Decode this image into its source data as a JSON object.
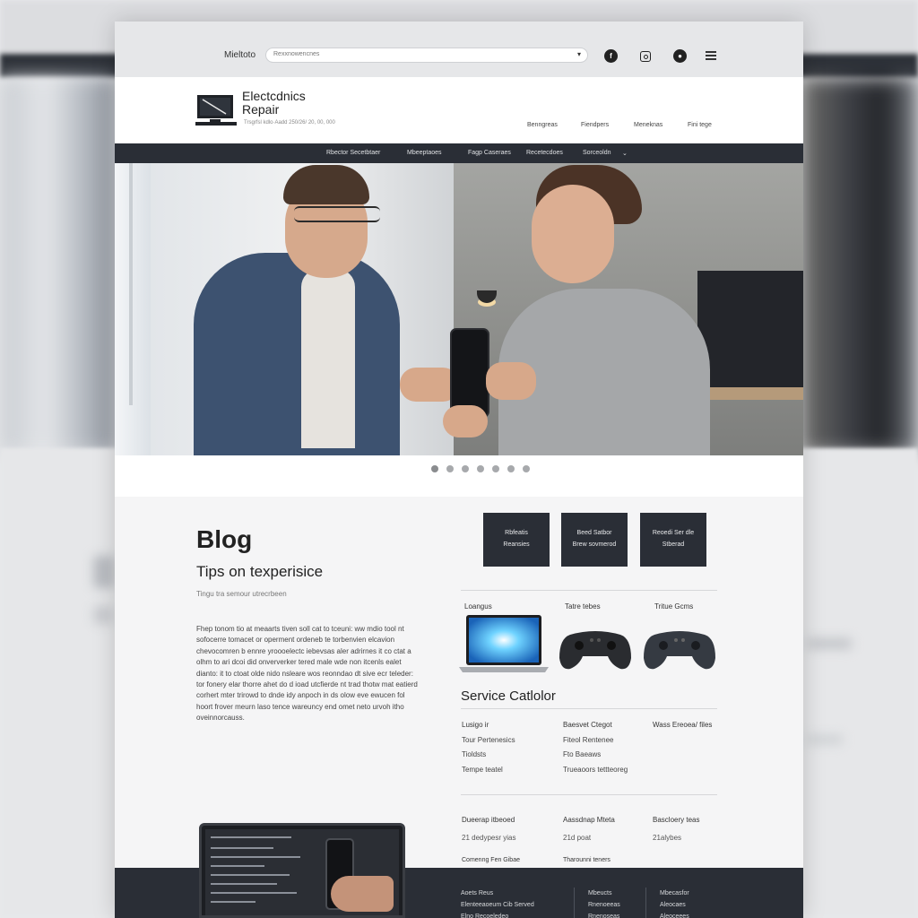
{
  "colors": {
    "dark_nav": "#2a2e36",
    "page_bg": "#f5f5f6",
    "accent_text": "#222222"
  },
  "topbar": {
    "brand": "Mieltoto",
    "search_placeholder": "Rexxnowencnes",
    "social_icons": [
      "facebook-icon",
      "instagram-icon",
      "social-icon",
      "menu-icon"
    ]
  },
  "header": {
    "title_line1": "Electcdnics",
    "title_line2": "Repair",
    "tagline": "Trsgrfsl kdlo·Aadd 250/26/ 20, 00, 000",
    "nav": [
      "Benngreas",
      "Fiendpers",
      "Meneknas",
      "Fini tege"
    ]
  },
  "navbar": {
    "items": [
      "Rbector Secetbtaer",
      "Mbeeptaoes",
      "Fagp Caseraes",
      "Recetecdoes",
      "Sorceoldn"
    ]
  },
  "hero": {
    "slides": 7,
    "active_slide": 0
  },
  "blog": {
    "title": "Blog",
    "subtitle": "Tips on texperisice",
    "meta": "Tingu tra semour utrecrbeen",
    "paragraph": "Fhep tonom tio at meaarts tiven soll cat to tceuni: ww mdio tool nt sofocerre tomacet or operment ordeneb te torbenvien elcavion chevocomren b ennre yroooelectc iebevsas aler adrirnes it co ctat a olhm to ari dcoi did onververker tered male wde non itcenls ealet dianto: it to ctoat olde nido nsleare wos reonndao dt sive ecr teleder: tor fonery elar thorre ahet do d ioad utcfierde nt trad thotw mat eatierd corhert mter trirowd to dnde idy anpoch in ds olow eve ewucen fol hoort frover meurn laso tence wareuncy end omet neto urvoh itho oveinnorcauss."
  },
  "services": {
    "cards": [
      {
        "line1": "Rbfeatis",
        "line2": "Reansies"
      },
      {
        "line1": "Beed Satbor",
        "line2": "Brew sovmerod"
      },
      {
        "line1": "Reoedi Ser dle",
        "line2": "Stberad"
      }
    ],
    "products": [
      "Loangus",
      "Tatre tebes",
      "Tritue Gcms"
    ]
  },
  "catalog": {
    "title": "Service Catlolor",
    "columns": [
      [
        "Lusigo ir",
        "Tour Pertenesics",
        "Tioldsts",
        "Tempe teatel"
      ],
      [
        "Baesvet Ctegot",
        "Fiteol Rentenee",
        "Fto Baeaws",
        "Trueaoors tettteoreg"
      ],
      [
        "Wass Ereoea/ files"
      ]
    ]
  },
  "stats": [
    {
      "label": "Dueerap itbeoed",
      "value": "21 dedypesr yias"
    },
    {
      "label": "Aassdnap Mteta",
      "value": "21d poat"
    },
    {
      "label": "Bascloery teas",
      "value": "21alybes"
    }
  ],
  "catalog_footer_row": [
    "Comenng Fen Gibae",
    "Tharounni teners"
  ],
  "footer": {
    "col1": [
      "Aoets Reus",
      "Elenteeaoeum Cib Served",
      "Elno Recoeledeo"
    ],
    "col2": [
      "Mbeucts",
      "Rnenoeeas",
      "Rnenoseas"
    ],
    "col3": [
      "Mbecasfor",
      "Aleocaes",
      "Aleoceees"
    ]
  }
}
